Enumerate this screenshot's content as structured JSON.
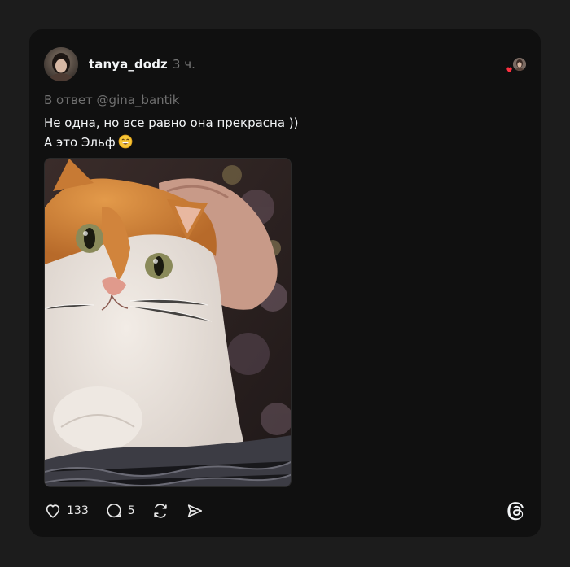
{
  "post": {
    "username": "tanya_dodz",
    "time": "3 ч.",
    "reply_to": "В ответ @gina_bantik",
    "text_line1": "Не одна, но все равно она прекрасна ))",
    "text_line2": "А это Эльф",
    "emoji": "grinning-face-emoji"
  },
  "actions": {
    "likes": "133",
    "replies": "5",
    "repost_icon": "repost-icon",
    "share_icon": "share-icon",
    "like_icon": "heart-icon",
    "reply_icon": "reply-icon"
  },
  "colors": {
    "background": "#1c1c1c",
    "card": "#101010",
    "text": "#f3f5f7",
    "muted": "#777777",
    "heart_red": "#ff3040"
  },
  "brand": {
    "logo": "threads-logo-icon"
  }
}
